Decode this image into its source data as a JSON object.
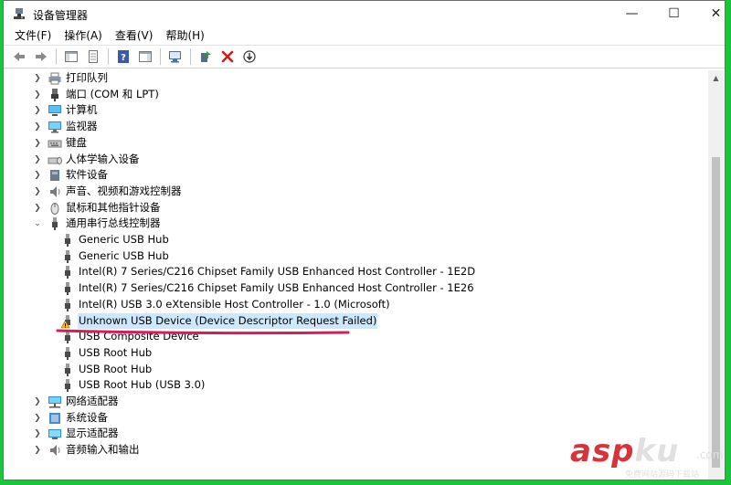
{
  "window": {
    "title": "设备管理器"
  },
  "window_controls": {
    "minimize": "—",
    "maximize": "☐",
    "close": "✕"
  },
  "menu": [
    "文件(F)",
    "操作(A)",
    "查看(V)",
    "帮助(H)"
  ],
  "toolbar": {
    "buttons": [
      "back-icon",
      "forward-icon",
      "show-hide-console-tree-icon",
      "properties-icon",
      "help-icon",
      "action-pane-icon",
      "scan-hardware-icon",
      "update-driver-icon",
      "uninstall-icon",
      "disable-device-icon"
    ]
  },
  "tree": {
    "categories_top": [
      {
        "label": "打印队列",
        "icon": "printer-icon"
      },
      {
        "label": "端口 (COM 和 LPT)",
        "icon": "port-icon"
      },
      {
        "label": "计算机",
        "icon": "computer-icon"
      },
      {
        "label": "监视器",
        "icon": "monitor-icon"
      },
      {
        "label": "键盘",
        "icon": "keyboard-icon"
      },
      {
        "label": "人体学输入设备",
        "icon": "hid-icon"
      },
      {
        "label": "软件设备",
        "icon": "software-device-icon"
      },
      {
        "label": "声音、视频和游戏控制器",
        "icon": "speaker-icon"
      },
      {
        "label": "鼠标和其他指针设备",
        "icon": "mouse-icon"
      }
    ],
    "expanded_category": {
      "label": "通用串行总线控制器",
      "icon": "usb-icon"
    },
    "usb_children": [
      {
        "label": "Generic USB Hub",
        "warning": false
      },
      {
        "label": "Generic USB Hub",
        "warning": false
      },
      {
        "label": "Intel(R) 7 Series/C216 Chipset Family USB Enhanced Host Controller - 1E2D",
        "warning": false
      },
      {
        "label": "Intel(R) 7 Series/C216 Chipset Family USB Enhanced Host Controller - 1E26",
        "warning": false
      },
      {
        "label": "Intel(R) USB 3.0 eXtensible Host Controller - 1.0 (Microsoft)",
        "warning": false
      },
      {
        "label": "Unknown USB Device (Device Descriptor Request Failed)",
        "warning": true,
        "selected": true
      },
      {
        "label": "USB Composite Device",
        "warning": false
      },
      {
        "label": "USB Root Hub",
        "warning": false
      },
      {
        "label": "USB Root Hub",
        "warning": false
      },
      {
        "label": "USB Root Hub (USB 3.0)",
        "warning": false
      }
    ],
    "categories_bottom": [
      {
        "label": "网络适配器",
        "icon": "network-adapter-icon"
      },
      {
        "label": "系统设备",
        "icon": "system-device-icon"
      },
      {
        "label": "显示适配器",
        "icon": "display-adapter-icon"
      },
      {
        "label": "音频输入和输出",
        "icon": "audio-io-icon"
      }
    ]
  },
  "watermark": {
    "main_red": "asp",
    "main_gray": "ku",
    "suffix": ".com",
    "sub": "免费网站源码下载站"
  },
  "colors": {
    "selection": "#cce8ff",
    "annotation": "#d81b60",
    "background": "#1bc43d"
  }
}
